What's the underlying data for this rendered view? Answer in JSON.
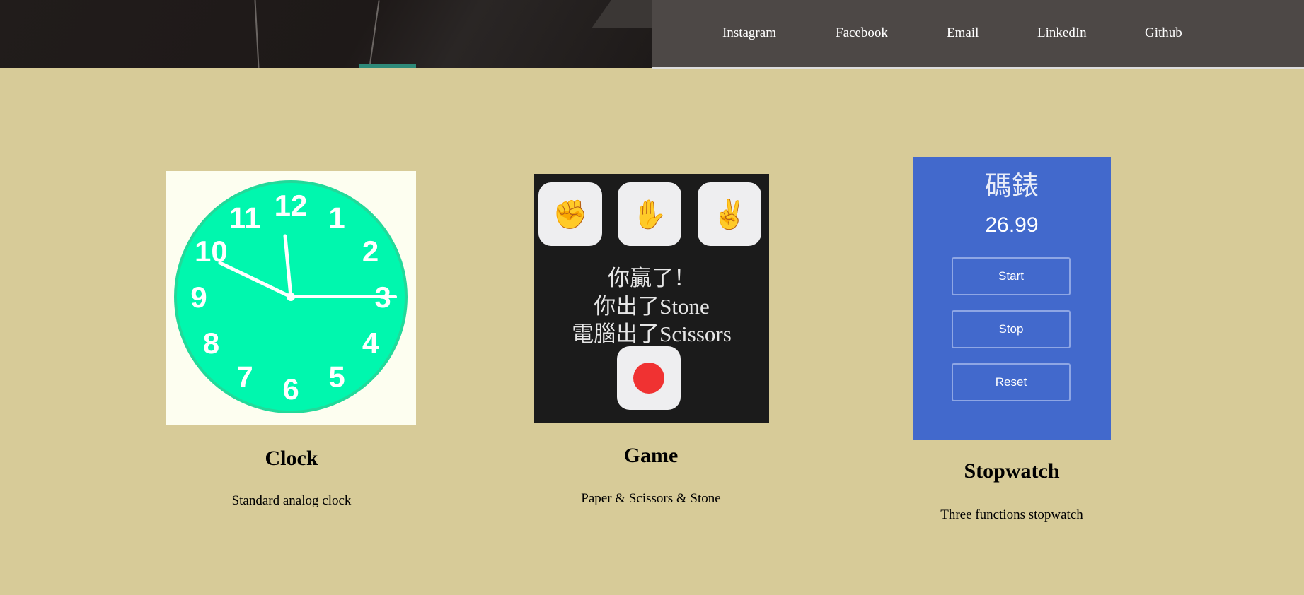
{
  "nav": {
    "items": [
      {
        "label": "Instagram"
      },
      {
        "label": "Facebook"
      },
      {
        "label": "Email"
      },
      {
        "label": "LinkedIn"
      },
      {
        "label": "Github"
      }
    ]
  },
  "projects": [
    {
      "title": "Clock",
      "description": "Standard analog clock",
      "preview": {
        "face_color": "#00f7ae",
        "numbers": [
          "12",
          "1",
          "2",
          "3",
          "4",
          "5",
          "6",
          "7",
          "8",
          "9",
          "10",
          "11"
        ]
      }
    },
    {
      "title": "Game",
      "description": "Paper & Scissors & Stone",
      "preview": {
        "choices": [
          {
            "icon": "fist-icon",
            "glyph": "✊"
          },
          {
            "icon": "hand-icon",
            "glyph": "✋"
          },
          {
            "icon": "victory-icon",
            "glyph": "✌"
          }
        ],
        "result": "你贏了！",
        "player_line": "你出了Stone",
        "computer_line": "電腦出了Scissors"
      }
    },
    {
      "title": "Stopwatch",
      "description": "Three functions stopwatch",
      "preview": {
        "title": "碼錶",
        "time": "26.99",
        "buttons": [
          "Start",
          "Stop",
          "Reset"
        ]
      }
    }
  ],
  "colors": {
    "page_bg": "#d7cb98",
    "nav_bg": "#4d4846",
    "stopwatch_bg": "#4269cc",
    "game_bg": "#1b1b1b",
    "record_red": "#f03232"
  }
}
